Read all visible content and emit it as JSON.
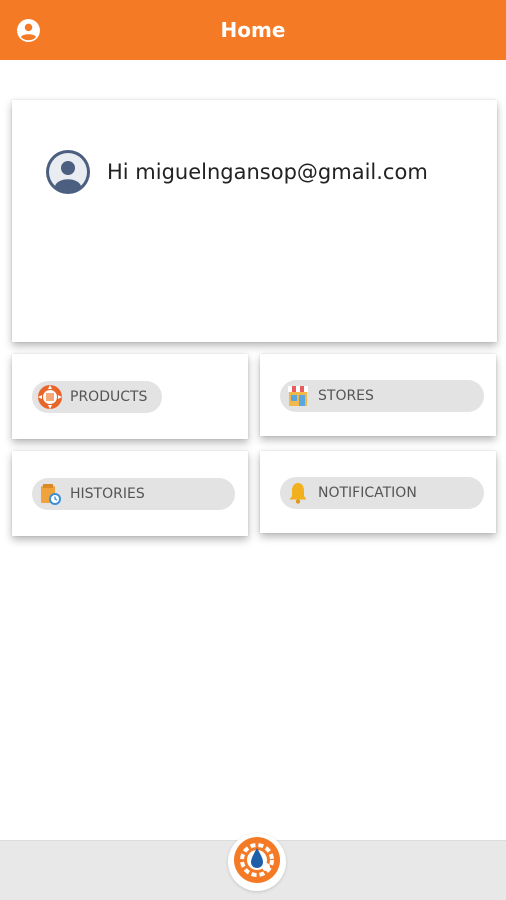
{
  "header": {
    "title": "Home",
    "account_icon": "account-circle-icon"
  },
  "profile": {
    "greeting": "Hi miguelngansop@gmail.com",
    "avatar_icon": "user-avatar-icon"
  },
  "tiles": [
    {
      "label": "PRODUCTS",
      "icon": "products-icon"
    },
    {
      "label": "STORES",
      "icon": "store-icon"
    },
    {
      "label": "HISTORIES",
      "icon": "history-icon"
    },
    {
      "label": "NOTIFICATION",
      "icon": "bell-icon"
    }
  ],
  "bottom": {
    "icon": "app-logo-icon"
  },
  "colors": {
    "accent": "#f47a25",
    "pill": "#e3e3e3",
    "bottom_bar": "#e8e8e8"
  }
}
